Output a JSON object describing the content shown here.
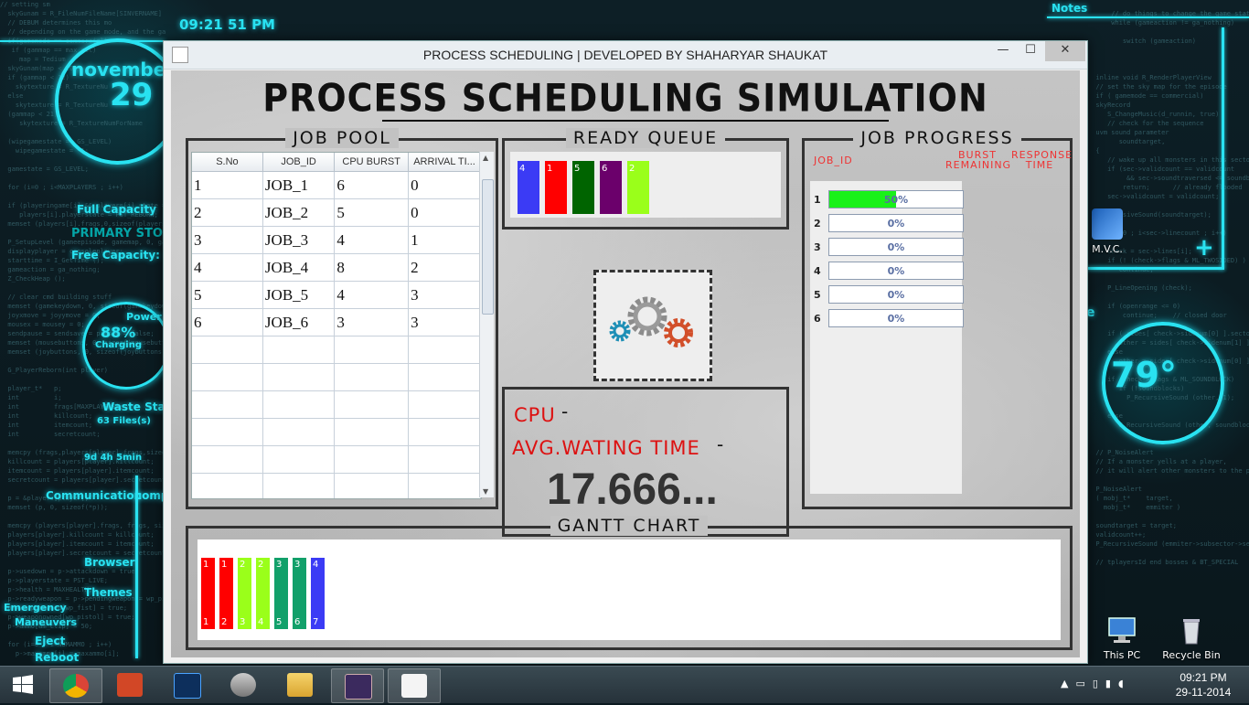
{
  "desktop": {
    "clock_time": "09:21 51 PM",
    "month": "novembe",
    "day": "29",
    "hud_full_capacity": "Full Capacity",
    "hud_free_capacity": "Free Capacity:",
    "hud_primary_storage": "PRIMARY STORAGE",
    "hud_power": "Power",
    "hud_battery": "88%",
    "hud_charging": "Charging",
    "hud_waste_status": "Waste Status",
    "hud_files": "63 Files(s)",
    "hud_uptime": "9d 4h 5min",
    "hud_communication": "Communication",
    "hud_browser": "Browser",
    "hud_themes": "Themes",
    "hud_emergency": "Emergency",
    "hud_maneuvers": "Maneuvers",
    "hud_eject": "Eject",
    "hud_reboot": "Reboot",
    "hud_comp": "comp",
    "notes": "Notes",
    "temperature": "79°",
    "icons": {
      "mvc": "M.V.C.",
      "this_pc": "This PC",
      "recycle_bin": "Recycle Bin"
    }
  },
  "window": {
    "title": "PROCESS SCHEDULING | DEVELOPED BY SHAHARYAR SHAUKAT",
    "minimize": "—",
    "maximize": "☐",
    "close": "✕"
  },
  "app": {
    "main_title": "PROCESS SCHEDULING SIMULATION",
    "job_pool": {
      "title": "JOB POOL",
      "columns": [
        "S.No",
        "JOB_ID",
        "CPU BURST",
        "ARRIVAL TI..."
      ],
      "rows": [
        [
          "1",
          "JOB_1",
          "6",
          "0"
        ],
        [
          "2",
          "JOB_2",
          "5",
          "0"
        ],
        [
          "3",
          "JOB_3",
          "4",
          "1"
        ],
        [
          "4",
          "JOB_4",
          "8",
          "2"
        ],
        [
          "5",
          "JOB_5",
          "4",
          "3"
        ],
        [
          "6",
          "JOB_6",
          "3",
          "3"
        ]
      ],
      "empty_rows": 6
    },
    "ready_queue": {
      "title": "READY QUEUE",
      "items": [
        {
          "label": "4",
          "color": "#3b3bf5"
        },
        {
          "label": "1",
          "color": "#ff0000"
        },
        {
          "label": "5",
          "color": "#006400"
        },
        {
          "label": "6",
          "color": "#6b006b"
        },
        {
          "label": "2",
          "color": "#9aff1a"
        }
      ]
    },
    "cpu": {
      "cpu_label": "CPU",
      "cpu_dash": "-",
      "avg_label": "AVG.WATING TIME",
      "avg_dash": "-",
      "avg_value": "17.666..."
    },
    "job_progress": {
      "title": "JOB PROGRESS",
      "col_job_id": "JOB_ID",
      "col_burst": "BURST REMAINING",
      "col_response": "RESPONSE TIME",
      "rows": [
        {
          "id": "1",
          "percent": 50,
          "label": "50%"
        },
        {
          "id": "2",
          "percent": 0,
          "label": "0%"
        },
        {
          "id": "3",
          "percent": 0,
          "label": "0%"
        },
        {
          "id": "4",
          "percent": 0,
          "label": "0%"
        },
        {
          "id": "5",
          "percent": 0,
          "label": "0%"
        },
        {
          "id": "6",
          "percent": 0,
          "label": "0%"
        }
      ]
    },
    "gantt": {
      "title": "GANTT CHART",
      "bars": [
        {
          "job": "1",
          "time": "1",
          "color": "#ff0000"
        },
        {
          "job": "1",
          "time": "2",
          "color": "#ff0000"
        },
        {
          "job": "2",
          "time": "3",
          "color": "#9aff1a"
        },
        {
          "job": "2",
          "time": "4",
          "color": "#9aff1a"
        },
        {
          "job": "3",
          "time": "5",
          "color": "#12a06a"
        },
        {
          "job": "3",
          "time": "6",
          "color": "#12a06a"
        },
        {
          "job": "4",
          "time": "7",
          "color": "#3b3bf5"
        }
      ]
    }
  },
  "taskbar": {
    "time": "09:21 PM",
    "date": "29-11-2014",
    "apps": [
      "start",
      "chrome",
      "office",
      "photoshop",
      "sql",
      "explorer",
      "java-ee-ide",
      "java"
    ]
  }
}
